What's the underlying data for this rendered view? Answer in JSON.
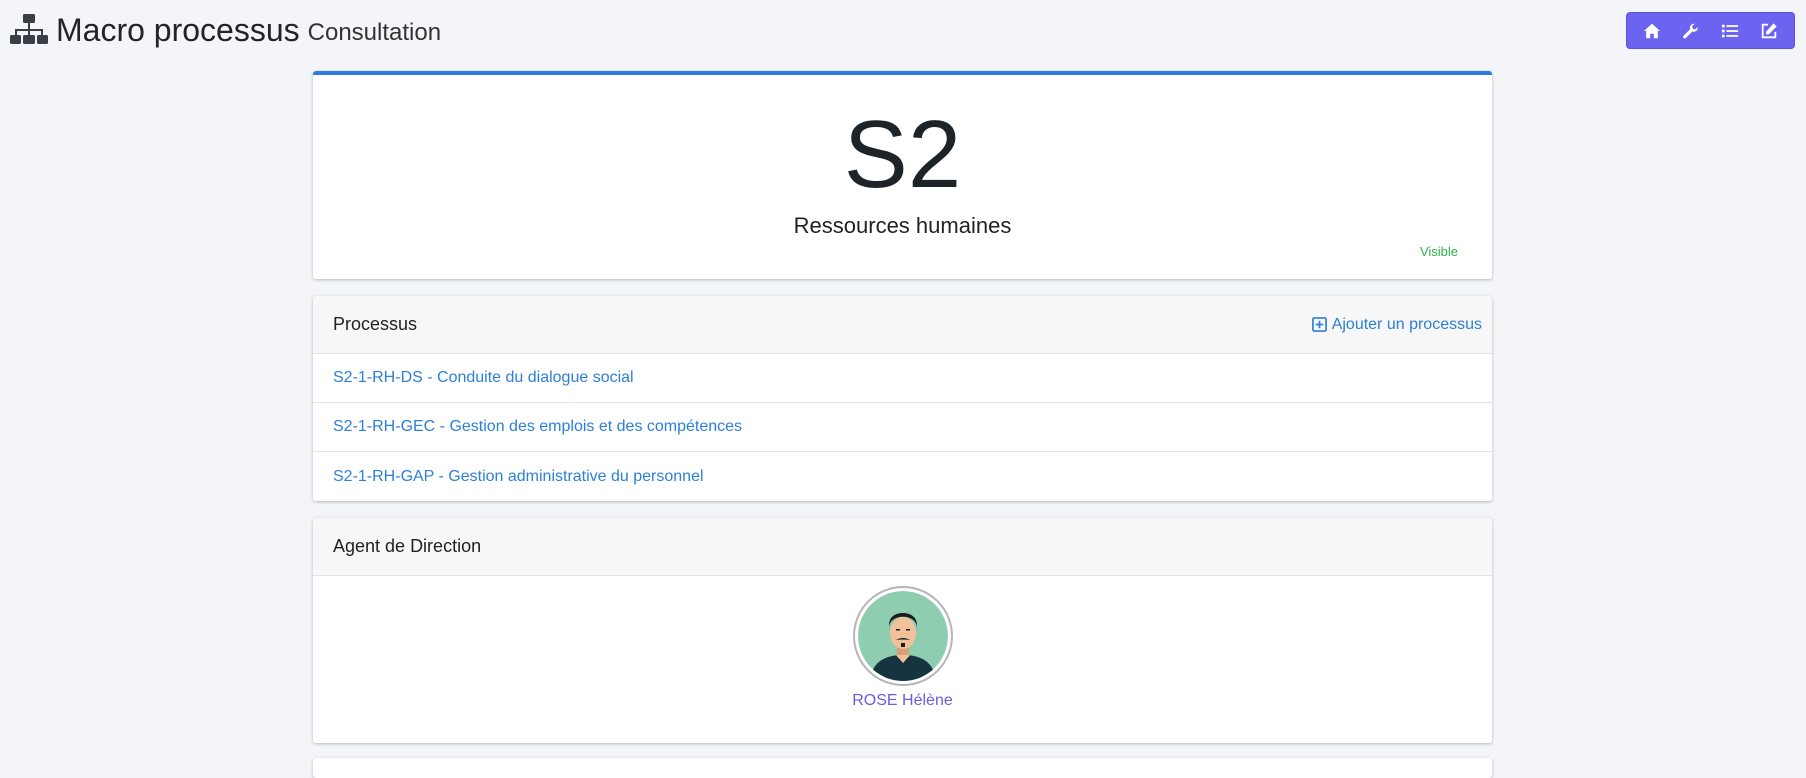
{
  "header": {
    "title": "Macro processus",
    "subtitle": "Consultation",
    "icon": "sitemap-icon"
  },
  "toolbar": {
    "color": "#6c63f0",
    "buttons": [
      {
        "icon": "home-icon"
      },
      {
        "icon": "wrench-icon"
      },
      {
        "icon": "list-icon"
      },
      {
        "icon": "edit-icon"
      }
    ]
  },
  "macro": {
    "code": "S2",
    "label": "Ressources humaines",
    "visibility": "Visible"
  },
  "processus": {
    "title": "Processus",
    "add_label": "Ajouter un processus",
    "items": [
      {
        "label": "S2-1-RH-DS - Conduite du dialogue social"
      },
      {
        "label": "S2-1-RH-GEC - Gestion des emplois et des compétences"
      },
      {
        "label": "S2-1-RH-GAP - Gestion administrative du personnel"
      }
    ]
  },
  "agent": {
    "title": "Agent de Direction",
    "name": "ROSE Hélène"
  },
  "colors": {
    "accent": "#2f7be0",
    "link": "#2d7fd8",
    "visible": "#2bb04a",
    "agent_link": "#6c5ce0"
  }
}
